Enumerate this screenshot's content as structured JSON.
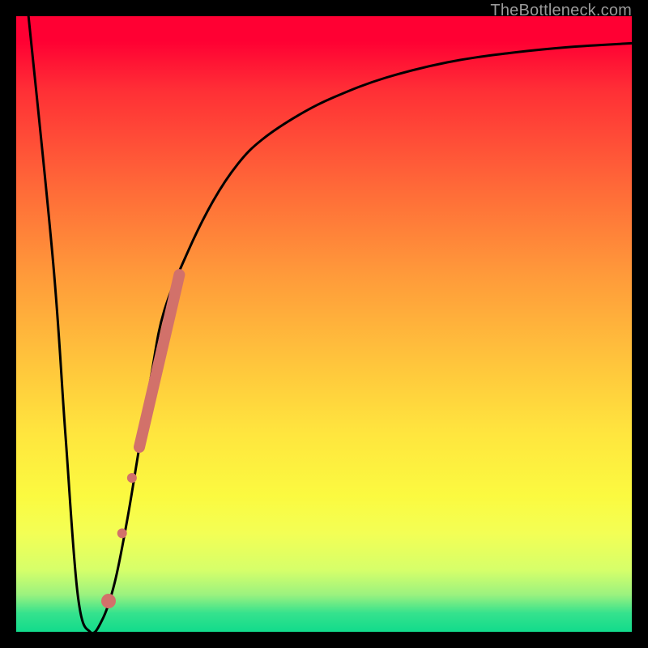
{
  "watermark": "TheBottleneck.com",
  "chart_data": {
    "type": "line",
    "title": "",
    "xlabel": "",
    "ylabel": "",
    "xlim": [
      0,
      100
    ],
    "ylim": [
      0,
      100
    ],
    "series": [
      {
        "name": "bottleneck-curve",
        "x": [
          2,
          6,
          8,
          10,
          12,
          14,
          16,
          18,
          20,
          22,
          24,
          28,
          32,
          36,
          40,
          46,
          52,
          60,
          70,
          80,
          90,
          100
        ],
        "values": [
          100,
          60,
          32,
          6,
          0,
          2,
          8,
          18,
          30,
          42,
          52,
          62,
          70,
          76,
          80,
          84,
          87,
          90,
          92.5,
          94,
          95,
          95.6
        ]
      }
    ],
    "markers": [
      {
        "name": "highlight-segment",
        "type": "thick-line",
        "x": [
          20,
          26.5
        ],
        "values": [
          30,
          58
        ],
        "color": "#d2716a",
        "width": 14
      },
      {
        "name": "highlight-dot-1",
        "type": "dot",
        "x": 18.8,
        "value": 25,
        "color": "#d2716a",
        "r": 6
      },
      {
        "name": "highlight-dot-2",
        "type": "dot",
        "x": 17.2,
        "value": 16,
        "color": "#d2716a",
        "r": 6
      },
      {
        "name": "highlight-dot-3",
        "type": "dot",
        "x": 15.0,
        "value": 5,
        "color": "#d2716a",
        "r": 9
      }
    ]
  }
}
